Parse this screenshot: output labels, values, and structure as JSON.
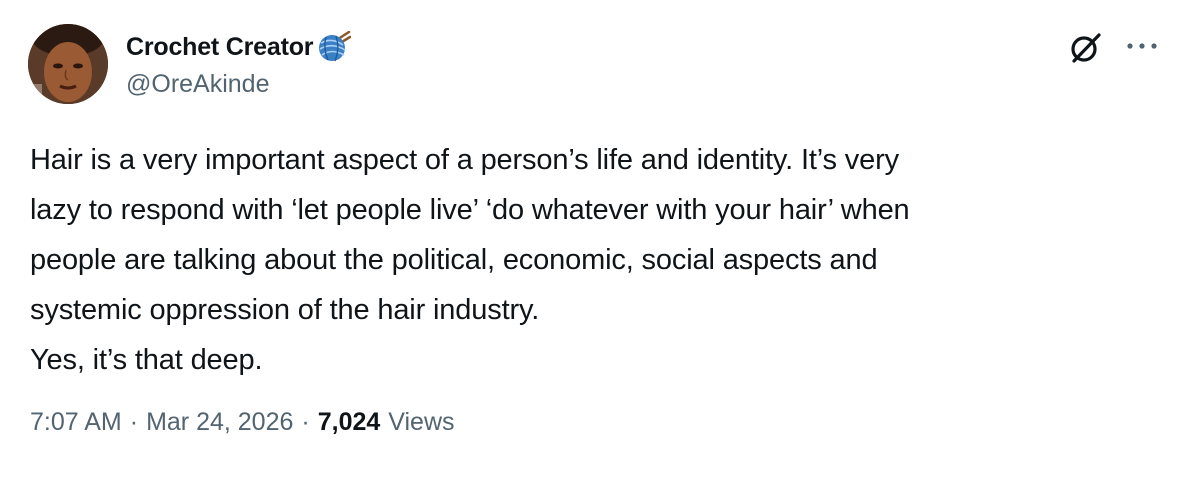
{
  "author": {
    "display_name": "Crochet Creator",
    "emoji_icon": "yarn-ball-icon",
    "handle": "@OreAkinde"
  },
  "tweet": {
    "lines": [
      "Hair is a very important aspect of a person’s life and identity. It’s very",
      "lazy to respond with ‘let people live’ ‘do whatever with your hair’ when",
      "people are talking about the political, economic, social aspects and",
      "systemic oppression of the hair industry.",
      "Yes, it’s that deep."
    ]
  },
  "meta": {
    "time": "7:07 AM",
    "separator": "·",
    "date": "Mar 24, 2026",
    "views_count": "7,024",
    "views_label": "Views"
  },
  "icons": {
    "grok": "grok-icon",
    "more": "more-dots-icon"
  },
  "colors": {
    "text_primary": "#0f1419",
    "text_secondary": "#536471",
    "yarn_blue": "#3b7fc4"
  }
}
